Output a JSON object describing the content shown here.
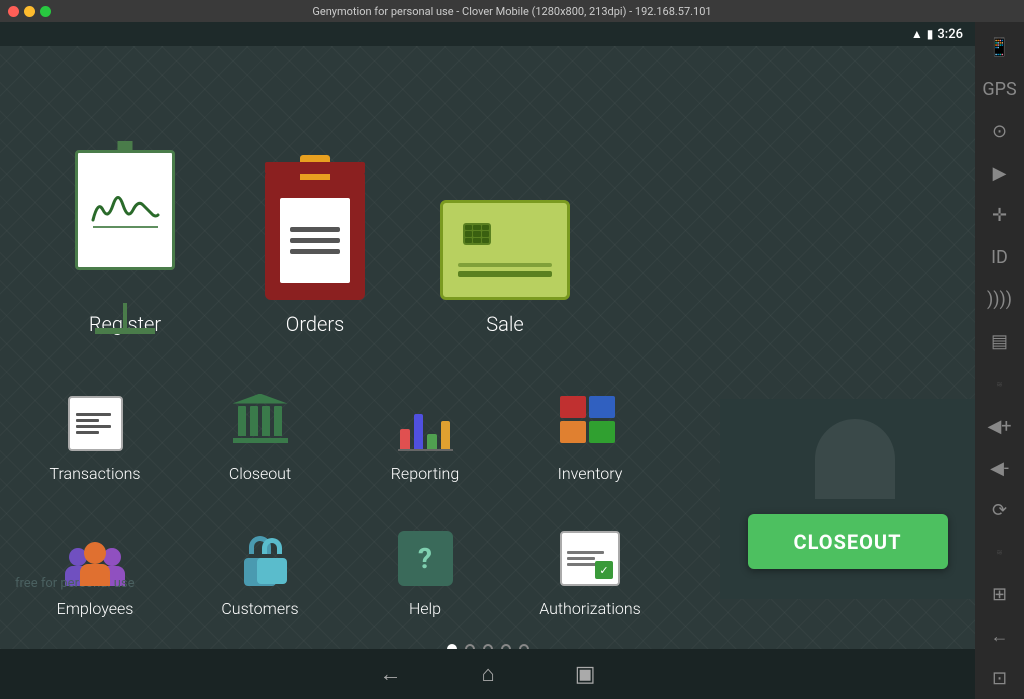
{
  "titleBar": {
    "text": "Genymotion for personal use - Clover Mobile (1280x800, 213dpi) - 192.168.57.101"
  },
  "statusBar": {
    "time": "3:26"
  },
  "apps": {
    "topRow": [
      {
        "id": "register",
        "label": "Register"
      },
      {
        "id": "orders",
        "label": "Orders"
      },
      {
        "id": "sale",
        "label": "Sale"
      }
    ],
    "bottomRow1": [
      {
        "id": "transactions",
        "label": "Transactions"
      },
      {
        "id": "closeout",
        "label": "Closeout"
      },
      {
        "id": "reporting",
        "label": "Reporting"
      },
      {
        "id": "inventory",
        "label": "Inventory"
      }
    ],
    "bottomRow2": [
      {
        "id": "employees",
        "label": "Employees"
      },
      {
        "id": "customers",
        "label": "Customers"
      },
      {
        "id": "help",
        "label": "Help"
      },
      {
        "id": "authorizations",
        "label": "Authorizations"
      }
    ]
  },
  "closeoutButton": {
    "label": "CLOSEOUT"
  },
  "watermark": {
    "text": "free for personal use"
  },
  "pageIndicators": {
    "total": 5,
    "active": 0
  },
  "navBar": {
    "back": "←",
    "home": "⌂",
    "recents": "▣"
  }
}
